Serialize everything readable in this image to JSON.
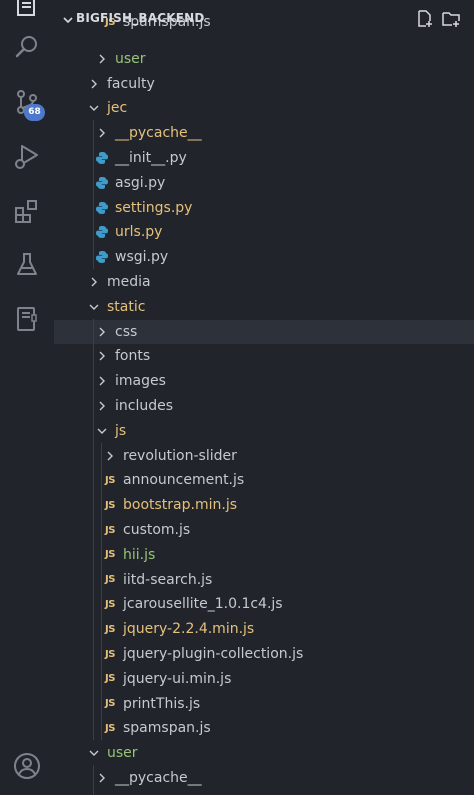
{
  "explorer": {
    "title": "BIGFISH_BACKEND"
  },
  "activity_bar": {
    "source_control_badge": "68"
  },
  "colors": {
    "default": "#c5c9d0",
    "modified": "#e5c07b",
    "untracked": "#98c379",
    "python": "#3d9ccc",
    "js": "#e5c07b"
  },
  "tree": [
    {
      "label": "spamspan.js",
      "kind": "js",
      "depth": 2,
      "status": "default",
      "clipped": true
    },
    {
      "label": "user",
      "kind": "folder",
      "depth": 1,
      "expanded": false,
      "status": "untracked"
    },
    {
      "label": "faculty",
      "kind": "folder",
      "depth": 0,
      "expanded": false,
      "status": "default"
    },
    {
      "label": "jec",
      "kind": "folder",
      "depth": 0,
      "expanded": true,
      "status": "modified"
    },
    {
      "label": "__pycache__",
      "kind": "folder",
      "depth": 1,
      "expanded": false,
      "status": "modified"
    },
    {
      "label": "__init__.py",
      "kind": "py",
      "depth": 1,
      "status": "default"
    },
    {
      "label": "asgi.py",
      "kind": "py",
      "depth": 1,
      "status": "default"
    },
    {
      "label": "settings.py",
      "kind": "py",
      "depth": 1,
      "status": "modified"
    },
    {
      "label": "urls.py",
      "kind": "py",
      "depth": 1,
      "status": "modified"
    },
    {
      "label": "wsgi.py",
      "kind": "py",
      "depth": 1,
      "status": "default"
    },
    {
      "label": "media",
      "kind": "folder",
      "depth": 0,
      "expanded": false,
      "status": "default"
    },
    {
      "label": "static",
      "kind": "folder",
      "depth": 0,
      "expanded": true,
      "status": "modified"
    },
    {
      "label": "css",
      "kind": "folder",
      "depth": 1,
      "expanded": false,
      "status": "default",
      "selected": true
    },
    {
      "label": "fonts",
      "kind": "folder",
      "depth": 1,
      "expanded": false,
      "status": "default"
    },
    {
      "label": "images",
      "kind": "folder",
      "depth": 1,
      "expanded": false,
      "status": "default"
    },
    {
      "label": "includes",
      "kind": "folder",
      "depth": 1,
      "expanded": false,
      "status": "default"
    },
    {
      "label": "js",
      "kind": "folder",
      "depth": 1,
      "expanded": true,
      "status": "modified"
    },
    {
      "label": "revolution-slider",
      "kind": "folder",
      "depth": 2,
      "expanded": false,
      "status": "default"
    },
    {
      "label": "announcement.js",
      "kind": "js",
      "depth": 2,
      "status": "default"
    },
    {
      "label": "bootstrap.min.js",
      "kind": "js",
      "depth": 2,
      "status": "modified"
    },
    {
      "label": "custom.js",
      "kind": "js",
      "depth": 2,
      "status": "default"
    },
    {
      "label": "hii.js",
      "kind": "js",
      "depth": 2,
      "status": "untracked"
    },
    {
      "label": "iitd-search.js",
      "kind": "js",
      "depth": 2,
      "status": "default"
    },
    {
      "label": "jcarousellite_1.0.1c4.js",
      "kind": "js",
      "depth": 2,
      "status": "default"
    },
    {
      "label": "jquery-2.2.4.min.js",
      "kind": "js",
      "depth": 2,
      "status": "modified"
    },
    {
      "label": "jquery-plugin-collection.js",
      "kind": "js",
      "depth": 2,
      "status": "default"
    },
    {
      "label": "jquery-ui.min.js",
      "kind": "js",
      "depth": 2,
      "status": "default"
    },
    {
      "label": "printThis.js",
      "kind": "js",
      "depth": 2,
      "status": "default"
    },
    {
      "label": "spamspan.js",
      "kind": "js",
      "depth": 2,
      "status": "default"
    },
    {
      "label": "user",
      "kind": "folder",
      "depth": 0,
      "expanded": true,
      "status": "untracked"
    },
    {
      "label": "__pycache__",
      "kind": "folder",
      "depth": 1,
      "expanded": false,
      "status": "default"
    }
  ]
}
